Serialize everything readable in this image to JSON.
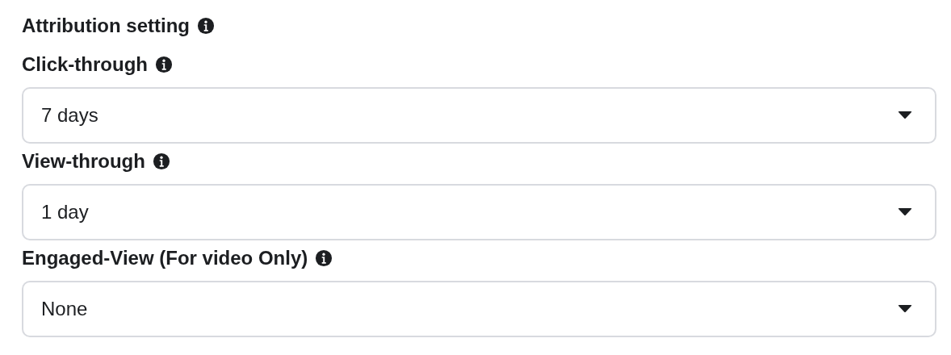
{
  "section": {
    "title": "Attribution setting"
  },
  "fields": [
    {
      "label": "Click-through",
      "value": "7 days"
    },
    {
      "label": "View-through",
      "value": "1 day"
    },
    {
      "label": "Engaged-View (For video Only)",
      "value": "None"
    }
  ]
}
